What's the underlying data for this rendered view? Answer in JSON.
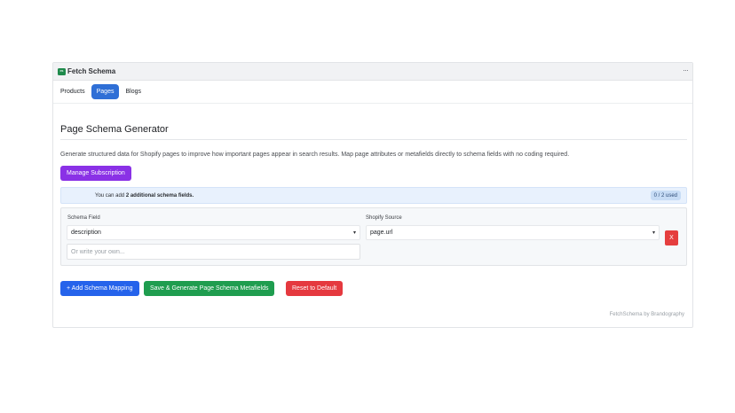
{
  "app": {
    "title": "Fetch Schema",
    "logo_text": "FS",
    "menu_icon": "more-horizontal-icon"
  },
  "tabs": [
    {
      "label": "Products",
      "active": false
    },
    {
      "label": "Pages",
      "active": true
    },
    {
      "label": "Blogs",
      "active": false
    }
  ],
  "page": {
    "title": "Page Schema Generator",
    "description": "Generate structured data for Shopify pages to improve how important pages appear in search results. Map page attributes or metafields directly to schema fields with no coding required."
  },
  "subscription": {
    "button_label": "Manage Subscription"
  },
  "info": {
    "prefix": "You can add ",
    "count_text": "2 additional schema fields.",
    "usage": "0 / 2 used"
  },
  "mapping": {
    "schema_field_label": "Schema Field",
    "schema_field_value": "description",
    "custom_placeholder": "Or write your own...",
    "source_label": "Shopify Source",
    "source_value": "page.url",
    "remove_label": "X"
  },
  "actions": {
    "add_label": "+ Add Schema Mapping",
    "save_label": "Save & Generate Page Schema Metafields",
    "reset_label": "Reset to Default"
  },
  "footer": {
    "text": "FetchSchema by Brandography"
  },
  "colors": {
    "accent_blue": "#2563eb",
    "tab_active": "#2f6fd6",
    "purple": "#8a31e6",
    "green": "#1f9d4f",
    "red": "#e5393f"
  }
}
